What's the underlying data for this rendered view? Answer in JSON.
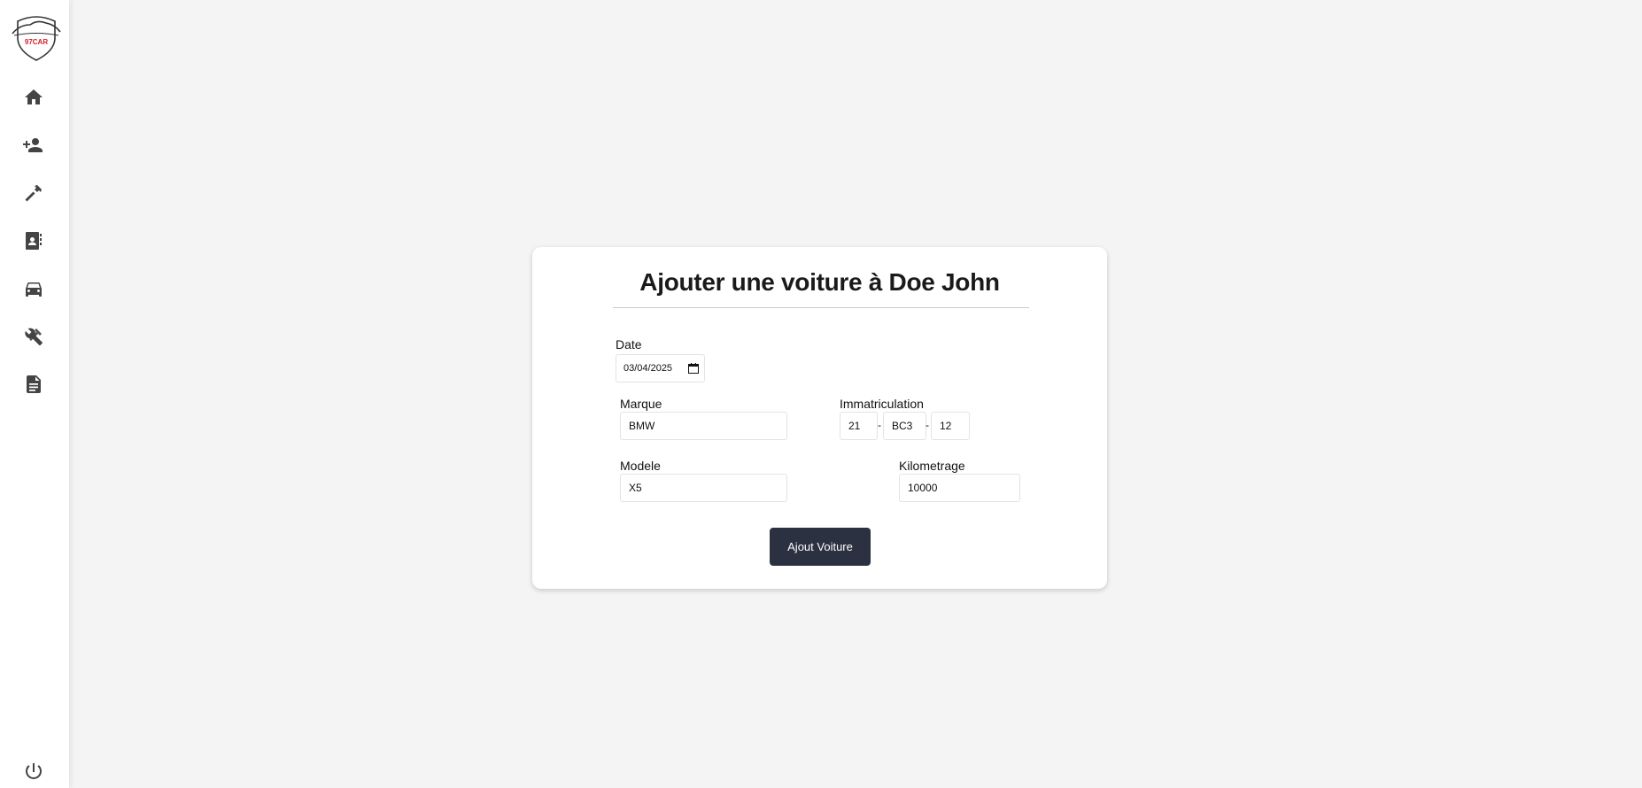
{
  "brand": {
    "logo_text": "97CAR"
  },
  "sidebar": {
    "items": [
      {
        "name": "home",
        "icon": "home-icon"
      },
      {
        "name": "add-client",
        "icon": "user-plus-icon"
      },
      {
        "name": "interventions",
        "icon": "hammer-icon"
      },
      {
        "name": "contacts",
        "icon": "contact-book-icon"
      },
      {
        "name": "cars",
        "icon": "car-icon"
      },
      {
        "name": "tools",
        "icon": "tools-icon"
      },
      {
        "name": "documents",
        "icon": "document-icon"
      }
    ],
    "logout_icon": "power-icon"
  },
  "form": {
    "title": "Ajouter une voiture à Doe John",
    "date": {
      "label": "Date",
      "value": "03/04/2025"
    },
    "marque": {
      "label": "Marque",
      "value": "BMW"
    },
    "immatriculation": {
      "label": "Immatriculation",
      "part1": "21",
      "part2": "BC3",
      "part3": "12",
      "separator": "-"
    },
    "modele": {
      "label": "Modele",
      "value": "X5"
    },
    "kilometrage": {
      "label": "Kilometrage",
      "value": "10000"
    },
    "submit_label": "Ajout Voiture"
  },
  "colors": {
    "background": "#f4f4f4",
    "button": "#2b3140",
    "logo_accent": "#d6202a"
  }
}
